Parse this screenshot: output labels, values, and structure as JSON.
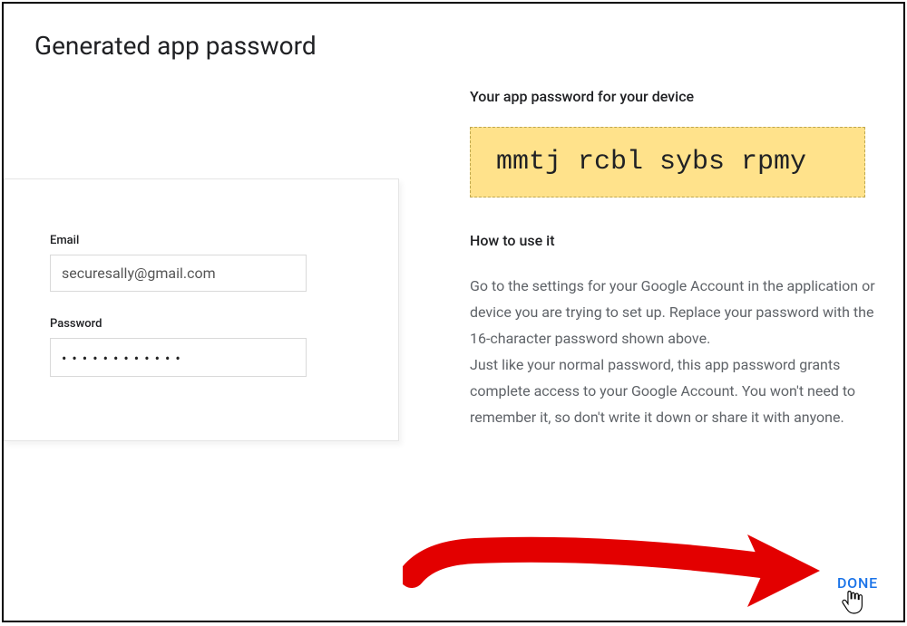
{
  "title": "Generated app password",
  "left": {
    "email_label": "Email",
    "email_value": "securesally@gmail.com",
    "password_label": "Password",
    "password_value": "••••••••••••"
  },
  "right": {
    "heading": "Your app password for your device",
    "generated_password": "mmtj rcbl sybs rpmy",
    "howto_heading": "How to use it",
    "instructions_p1": "Go to the settings for your Google Account in the application or device you are trying to set up. Replace your password with the 16-character password shown above.",
    "instructions_p2": "Just like your normal password, this app password grants complete access to your Google Account. You won't need to remember it, so don't write it down or share it with anyone."
  },
  "done_label": "DONE"
}
